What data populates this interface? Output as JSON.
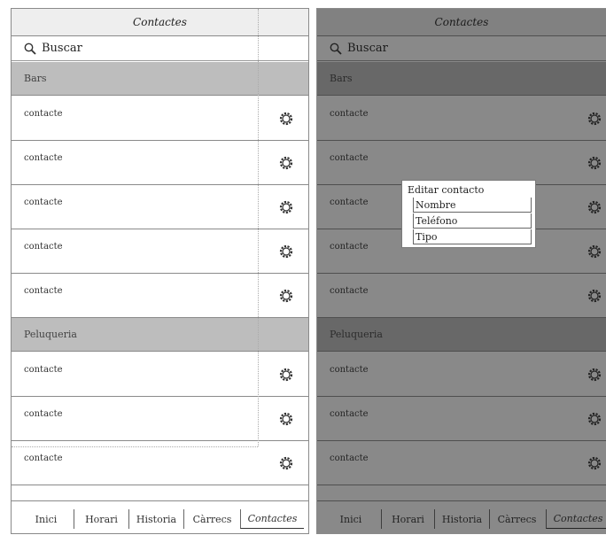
{
  "screen_title": "Contactes",
  "search": {
    "label": "Buscar"
  },
  "sections": [
    {
      "title": "Bars",
      "contacts": [
        "contacte",
        "contacte",
        "contacte",
        "contacte",
        "contacte"
      ]
    },
    {
      "title": "Peluqueria",
      "contacts": [
        "contacte",
        "contacte",
        "contacte"
      ]
    }
  ],
  "tabs": [
    "Inici",
    "Horari",
    "Historia",
    "Càrrecs",
    "Contactes"
  ],
  "active_tab": "Contactes",
  "dialog": {
    "title": "Editar contacto",
    "fields": [
      "Nombre",
      "Teléfono",
      "Tipo"
    ]
  },
  "icons": {
    "search": "magnifier-icon",
    "row_action": "gear-icon"
  },
  "colors": {
    "section_bg": "#bdbdbd",
    "overlay": "#141414"
  }
}
